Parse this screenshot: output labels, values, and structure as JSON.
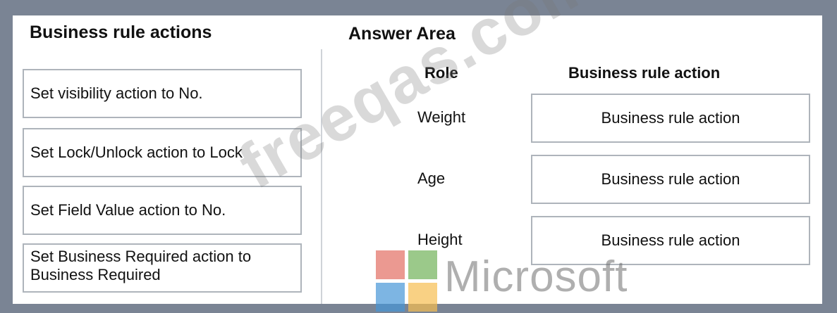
{
  "left_panel": {
    "heading": "Business rule actions",
    "actions": [
      {
        "label": "Set visibility action to No."
      },
      {
        "label": "Set Lock/Unlock action to Lock"
      },
      {
        "label": "Set Field Value action to No."
      },
      {
        "label": "Set Business Required action to Business Required"
      }
    ]
  },
  "answer_area": {
    "heading": "Answer Area",
    "role_header": "Role",
    "action_header": "Business rule action",
    "rows": [
      {
        "role": "Weight",
        "target": "Business rule action"
      },
      {
        "role": "Age",
        "target": "Business rule action"
      },
      {
        "role": "Height",
        "target": "Business rule action"
      }
    ]
  },
  "watermark": {
    "text": "freeqas.com"
  },
  "logo": {
    "text": "Microsoft",
    "colors": [
      "#e26e62",
      "#70b258",
      "#4696d7",
      "#f6be50"
    ]
  }
}
